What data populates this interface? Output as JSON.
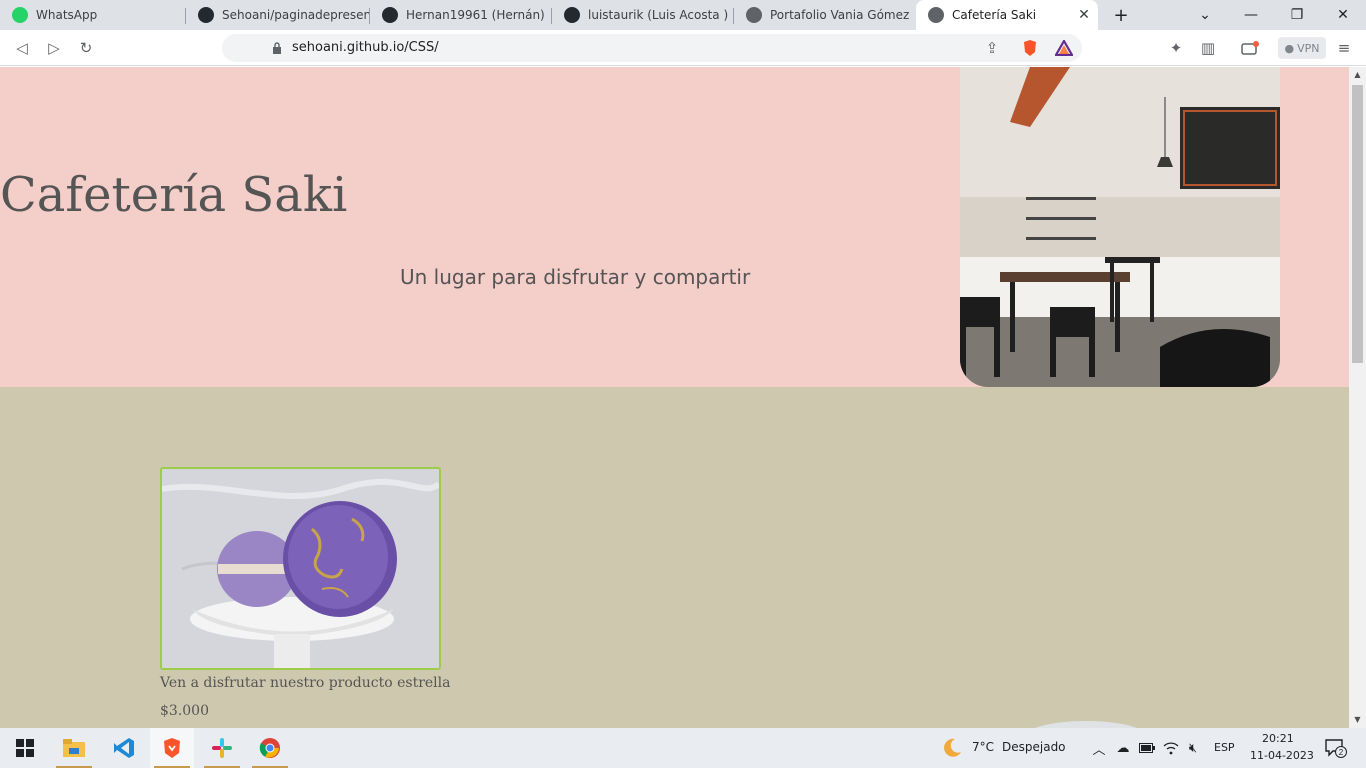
{
  "browser": {
    "tabs": [
      {
        "label": "WhatsApp",
        "icon": "whatsapp-icon",
        "active": false
      },
      {
        "label": "Sehoani/paginadepresentac",
        "icon": "github-icon",
        "active": false
      },
      {
        "label": "Hernan19961 (Hernán)",
        "icon": "github-icon",
        "active": false
      },
      {
        "label": "luistaurik (Luis Acosta )",
        "icon": "github-icon",
        "active": false
      },
      {
        "label": "Portafolio Vania Gómez",
        "icon": "globe-icon",
        "active": false
      },
      {
        "label": "Cafetería Saki",
        "icon": "globe-icon",
        "active": true
      }
    ],
    "address": "sehoani.github.io/CSS/",
    "vpn_label": "VPN"
  },
  "page": {
    "title": "Cafetería Saki",
    "tagline": "Un lugar para disfrutar y compartir",
    "product": {
      "description": "Ven a disfrutar nuestro producto estrella",
      "price": "$3.000"
    }
  },
  "taskbar": {
    "weather_temp": "7°C",
    "weather_desc": "Despejado",
    "language": "ESP",
    "time": "20:21",
    "date": "11-04-2023",
    "notification_count": "2"
  },
  "colors": {
    "hero_bg": "#f4cec8",
    "body_bg": "#cdc8ae",
    "product_border": "#9ccc4a",
    "text": "#555555"
  }
}
